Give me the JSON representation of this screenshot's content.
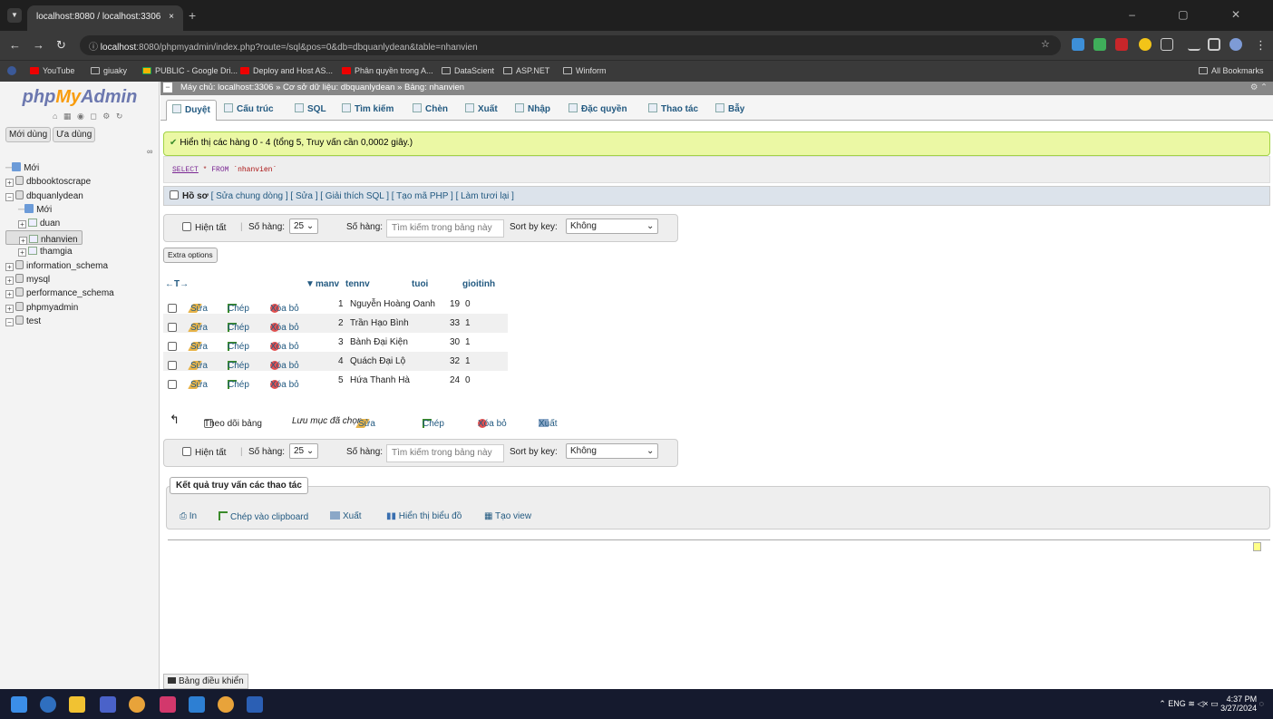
{
  "browser": {
    "tab_title": "localhost:8080 / localhost:3306",
    "tab_close": "×",
    "new_tab": "+",
    "url_host": "localhost",
    "url_rest": ":8080/phpmyadmin/index.php?route=/sql&pos=0&db=dbquanlydean&table=nhanvien",
    "window_controls": "–  ▢  ✕",
    "bookmarks": [
      "YouTube",
      "giuaky",
      "PUBLIC - Google Dri...",
      "Deploy and Host AS...",
      "Phân quyền trong A...",
      "DataScient",
      "ASP.NET",
      "Winform"
    ],
    "all_bookmarks": "All Bookmarks"
  },
  "sidebar": {
    "logo_php": "php",
    "logo_my": "My",
    "logo_admin": "Admin",
    "tab_recent": "Mới dùng",
    "tab_favorite": "Ưa dùng",
    "tree": [
      {
        "label": "Mới",
        "level": 0,
        "kind": "new"
      },
      {
        "label": "dbbooktoscrape",
        "level": 0,
        "kind": "db"
      },
      {
        "label": "dbquanlydean",
        "level": 0,
        "kind": "db"
      },
      {
        "label": "Mới",
        "level": 1,
        "kind": "new"
      },
      {
        "label": "duan",
        "level": 1,
        "kind": "table"
      },
      {
        "label": "nhanvien",
        "level": 1,
        "kind": "table"
      },
      {
        "label": "thamgia",
        "level": 1,
        "kind": "table"
      },
      {
        "label": "information_schema",
        "level": 0,
        "kind": "db"
      },
      {
        "label": "mysql",
        "level": 0,
        "kind": "db"
      },
      {
        "label": "performance_schema",
        "level": 0,
        "kind": "db"
      },
      {
        "label": "phpmyadmin",
        "level": 0,
        "kind": "db"
      },
      {
        "label": "test",
        "level": 0,
        "kind": "db"
      }
    ]
  },
  "breadcrumb": {
    "server": "Máy chủ: localhost:3306",
    "db": "Cơ sở dữ liệu: dbquanlydean",
    "table": "Bảng: nhanvien",
    "sep": "»"
  },
  "tabs": [
    "Duyệt",
    "Cấu trúc",
    "SQL",
    "Tìm kiếm",
    "Chèn",
    "Xuất",
    "Nhập",
    "Đặc quyền",
    "Thao tác",
    "Bẫy"
  ],
  "success": "Hiển thị các hàng 0 - 4 (tổng 5, Truy vấn cần 0,0002 giây.)",
  "sql": {
    "select": "SELECT",
    "star": "*",
    "from": "FROM",
    "table": "`nhanvien`"
  },
  "profile": {
    "label": "Hồ sơ",
    "links": "[ Sửa chung dòng ] [ Sửa ] [ Giải thích SQL ] [ Tạo mã PHP ] [ Làm tươi lại ]"
  },
  "nav": {
    "show_all": "Hiện tất",
    "rows_label": "Số hàng:",
    "rows_value": "25 ⌄",
    "filter_label": "Số hàng:",
    "filter_placeholder": "Tìm kiếm trong bảng này",
    "sort_label": "Sort by key:",
    "sort_value": "Không"
  },
  "extra_options": "Extra options",
  "grid": {
    "arrows": "←T→",
    "columns": [
      "manv",
      "tennv",
      "tuoi",
      "gioitinh"
    ],
    "actions": {
      "edit": "Sửa",
      "copy": "Chép",
      "delete": "Xóa bỏ"
    },
    "rows": [
      {
        "manv": "1",
        "tennv": "Nguyễn Hoàng Oanh",
        "tuoi": "19",
        "gioitinh": "0"
      },
      {
        "manv": "2",
        "tennv": "Trần Hạo Bình",
        "tuoi": "33",
        "gioitinh": "1"
      },
      {
        "manv": "3",
        "tennv": "Bành Đại Kiện",
        "tuoi": "30",
        "gioitinh": "1"
      },
      {
        "manv": "4",
        "tennv": "Quách Đại Lộ",
        "tuoi": "32",
        "gioitinh": "1"
      },
      {
        "manv": "5",
        "tennv": "Hứa Thanh Hà",
        "tuoi": "24",
        "gioitinh": "0"
      }
    ]
  },
  "bulk": {
    "check_all": "Theo dõi bảng",
    "with_selected": "Lưu mục đã chọn",
    "edit": "Sửa",
    "copy": "Chép",
    "delete": "Xóa bỏ",
    "export": "Xuất"
  },
  "query_ops": {
    "legend": "Kết quả truy vấn các thao tác",
    "print": "In",
    "copy": "Chép vào clipboard",
    "export": "Xuất",
    "chart": "Hiển thị biểu đồ",
    "view": "Tạo view"
  },
  "console": "Bảng điều khiển",
  "taskbar": {
    "lang": "ENG",
    "time": "4:37 PM",
    "date": "3/27/2024"
  }
}
